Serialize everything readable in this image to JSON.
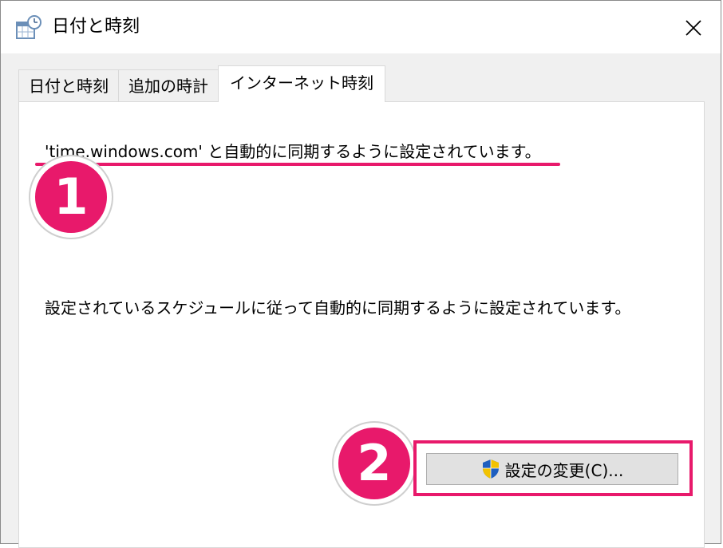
{
  "window": {
    "title": "日付と時刻",
    "close_glyph": "✕"
  },
  "tabs": [
    {
      "label": "日付と時刻",
      "active": false
    },
    {
      "label": "追加の時計",
      "active": false
    },
    {
      "label": "インターネット時刻",
      "active": true
    }
  ],
  "panel": {
    "sync_status": "'time.windows.com' と自動的に同期するように設定されています。",
    "schedule_status": "設定されているスケジュールに従って自動的に同期するように設定されています。",
    "change_settings_label": "設定の変更(C)..."
  },
  "annotations": {
    "badge_1": "1",
    "badge_2": "2",
    "color": "#e8196b"
  },
  "icons": {
    "app": "date-time-icon",
    "close": "close-icon",
    "shield": "uac-shield-icon"
  }
}
